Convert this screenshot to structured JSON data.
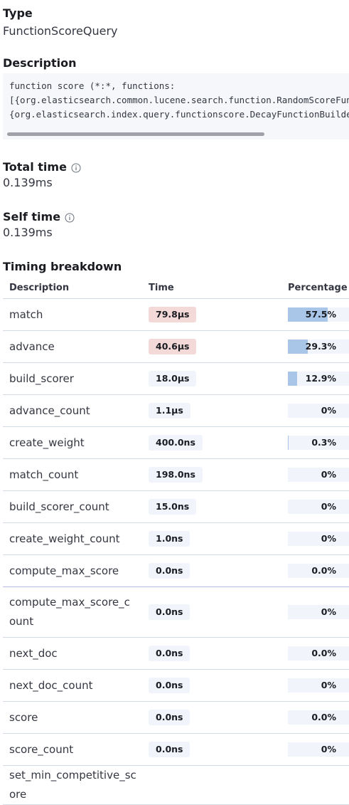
{
  "type": {
    "heading": "Type",
    "value": "FunctionScoreQuery"
  },
  "description": {
    "heading": "Description",
    "lines": [
      "function score (*:*, functions:",
      "[{org.elasticsearch.common.lucene.search.function.RandomScoreFunction",
      "{org.elasticsearch.index.query.functionscore.DecayFunctionBuilder"
    ]
  },
  "total_time": {
    "heading": "Total time",
    "value": "0.139ms"
  },
  "self_time": {
    "heading": "Self time",
    "value": "0.139ms"
  },
  "breakdown": {
    "heading": "Timing breakdown",
    "columns": {
      "description": "Description",
      "time": "Time",
      "percentage": "Percentage"
    },
    "rows": [
      {
        "description": "match",
        "time": "79.8µs",
        "percentage": "57.5%",
        "percent_value": 57.5,
        "hot": true
      },
      {
        "description": "advance",
        "time": "40.6µs",
        "percentage": "29.3%",
        "percent_value": 29.3,
        "hot": true
      },
      {
        "description": "build_scorer",
        "time": "18.0µs",
        "percentage": "12.9%",
        "percent_value": 12.9,
        "hot": false
      },
      {
        "description": "advance_count",
        "time": "1.1µs",
        "percentage": "0%",
        "percent_value": 0,
        "hot": false
      },
      {
        "description": "create_weight",
        "time": "400.0ns",
        "percentage": "0.3%",
        "percent_value": 0.3,
        "hot": false
      },
      {
        "description": "match_count",
        "time": "198.0ns",
        "percentage": "0%",
        "percent_value": 0,
        "hot": false
      },
      {
        "description": "build_scorer_count",
        "time": "15.0ns",
        "percentage": "0%",
        "percent_value": 0,
        "hot": false
      },
      {
        "description": "create_weight_count",
        "time": "1.0ns",
        "percentage": "0%",
        "percent_value": 0,
        "hot": false
      },
      {
        "description": "compute_max_score",
        "time": "0.0ns",
        "percentage": "0.0%",
        "percent_value": 0,
        "hot": false
      },
      {
        "description": "compute_max_score_count",
        "time": "0.0ns",
        "percentage": "0%",
        "percent_value": 0,
        "hot": false
      },
      {
        "description": "next_doc",
        "time": "0.0ns",
        "percentage": "0.0%",
        "percent_value": 0,
        "hot": false
      },
      {
        "description": "next_doc_count",
        "time": "0.0ns",
        "percentage": "0%",
        "percent_value": 0,
        "hot": false
      },
      {
        "description": "score",
        "time": "0.0ns",
        "percentage": "0.0%",
        "percent_value": 0,
        "hot": false
      },
      {
        "description": "score_count",
        "time": "0.0ns",
        "percentage": "0%",
        "percent_value": 0,
        "hot": false
      },
      {
        "description": "set_min_competitive_score",
        "time": "",
        "percentage": "",
        "percent_value": 0,
        "hot": false
      }
    ]
  }
}
